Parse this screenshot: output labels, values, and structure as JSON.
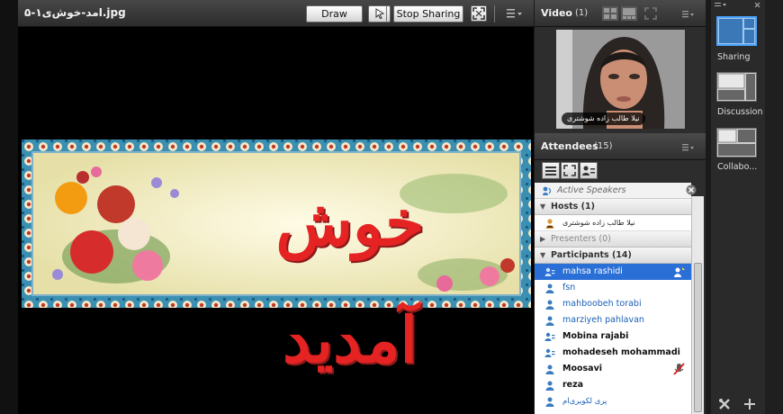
{
  "share": {
    "title": "امد-خوش‌ی۱-۵.jpg",
    "draw_label": "Draw",
    "stop_sharing_label": "Stop Sharing",
    "banner_text": "خوش آمدید"
  },
  "video": {
    "title": "Video",
    "count": "(1)",
    "presenter_name": "نیلا طالب زاده شوشتری"
  },
  "attendees": {
    "title": "Attendees",
    "count": "(15)",
    "active_speakers": "Active Speakers",
    "hosts_label": "Hosts (1)",
    "host_name": "نیلا طالب زاده شوشتری",
    "presenters_label": "Presenters (0)",
    "participants_label": "Participants (14)",
    "participants": [
      {
        "name": "mahsa rashidi",
        "style": "sel"
      },
      {
        "name": "fsn",
        "style": "blue"
      },
      {
        "name": "mahboobeh torabi",
        "style": "blue"
      },
      {
        "name": "marziyeh pahlavan",
        "style": "blue"
      },
      {
        "name": "Mobina rajabi",
        "style": "dark"
      },
      {
        "name": "mohadeseh mohammadi",
        "style": "dark"
      },
      {
        "name": "Moosavi",
        "style": "dark"
      },
      {
        "name": "reza",
        "style": "dark"
      },
      {
        "name": "پری لکویری‌ام",
        "style": "blue"
      }
    ]
  },
  "layouts": [
    {
      "label": "Sharing",
      "active": true
    },
    {
      "label": "Discussion",
      "active": false
    },
    {
      "label": "Collabo...",
      "active": false
    }
  ],
  "colors": {
    "selection": "#2a6fd6",
    "participant_blue": "#1a5fb4",
    "active_layout_border": "#4aa3ff"
  }
}
